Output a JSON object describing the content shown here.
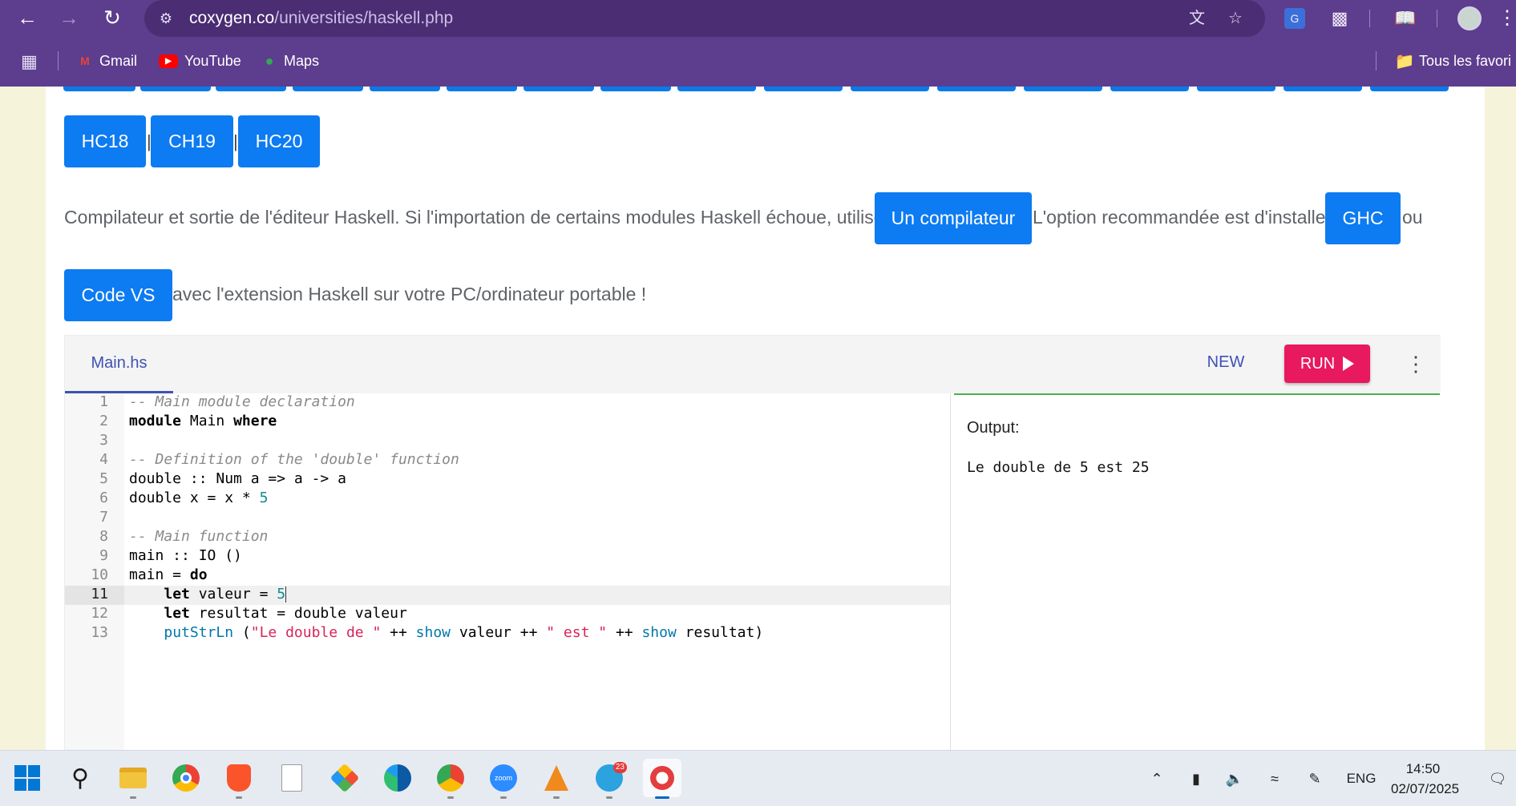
{
  "browser": {
    "url_host": "coxygen.co",
    "url_path": "/universities/haskell.php",
    "bookmarks": [
      {
        "label": "Gmail",
        "icon": "gmail-icon"
      },
      {
        "label": "YouTube",
        "icon": "youtube-icon"
      },
      {
        "label": "Maps",
        "icon": "maps-icon"
      }
    ],
    "all_bookmarks_label": "Tous les favori"
  },
  "page": {
    "hc_buttons": [
      "HC18",
      "CH19",
      "HC20"
    ],
    "separator": "|",
    "paragraph": {
      "part1": "Compilateur et sortie de l'éditeur Haskell. Si l'importation de certains modules Haskell échoue, utilisez",
      "btn_compiler": "Un compilateur",
      "part2": "L'option recommandée est d'installer",
      "btn_ghc": "GHC",
      "part3": "ou",
      "btn_vscode": "Code VS",
      "part4": "avec l'extension Haskell sur votre PC/ordinateur portable !"
    }
  },
  "editor": {
    "tab_label": "Main.hs",
    "new_label": "NEW",
    "run_label": "RUN",
    "line_numbers": [
      "1",
      "2",
      "3",
      "4",
      "5",
      "6",
      "7",
      "8",
      "9",
      "10",
      "11",
      "12",
      "13"
    ],
    "active_line": "11",
    "code_lines": [
      "-- Main module declaration",
      "module Main where",
      "",
      "-- Definition of the 'double' function",
      "double :: Num a => a -> a",
      "double x = x * 5",
      "",
      "-- Main function",
      "main :: IO ()",
      "main = do",
      "    let valeur = 5",
      "    let resultat = double valeur",
      "    putStrLn (\"Le double de \" ++ show valeur ++ \" est \" ++ show resultat)"
    ],
    "output_label": "Output:",
    "output_text": "Le double de 5 est 25"
  },
  "taskbar": {
    "apps": [
      "windows-start",
      "search",
      "file-explorer",
      "chrome",
      "brave",
      "notepad",
      "git",
      "edge",
      "chrome-profile",
      "zoom",
      "vlc",
      "telegram",
      "snipping-tool"
    ],
    "telegram_badge": "23",
    "zoom_label": "zoom",
    "language": "ENG",
    "time": "14:50",
    "date": "02/07/2025"
  },
  "colors": {
    "chrome_purple": "#5d3d8e",
    "button_blue": "#0d7bf2",
    "run_pink": "#e8195e",
    "tab_indigo": "#3f51b5",
    "output_green": "#4caf50"
  }
}
